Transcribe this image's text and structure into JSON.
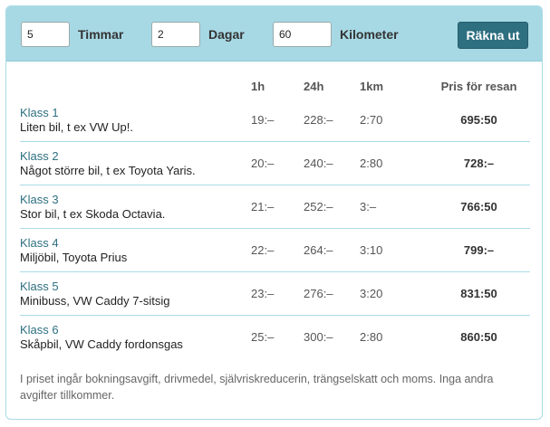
{
  "form": {
    "hours_value": "5",
    "hours_label": "Timmar",
    "days_value": "2",
    "days_label": "Dagar",
    "km_value": "60",
    "km_label": "Kilometer",
    "submit_label": "Räkna ut"
  },
  "table": {
    "headers": {
      "hour": "1h",
      "day": "24h",
      "km": "1km",
      "price": "Pris för resan"
    },
    "rows": [
      {
        "klass": "Klass 1",
        "desc": "Liten bil, t ex VW Up!.",
        "hour": "19:–",
        "day": "228:–",
        "km": "2:70",
        "price": "695:50"
      },
      {
        "klass": "Klass 2",
        "desc": "Något större bil, t ex Toyota Yaris.",
        "hour": "20:–",
        "day": "240:–",
        "km": "2:80",
        "price": "728:–"
      },
      {
        "klass": "Klass 3",
        "desc": "Stor bil, t ex Skoda Octavia.",
        "hour": "21:–",
        "day": "252:–",
        "km": "3:–",
        "price": "766:50"
      },
      {
        "klass": "Klass 4",
        "desc": "Miljöbil, Toyota Prius",
        "hour": "22:–",
        "day": "264:–",
        "km": "3:10",
        "price": "799:–"
      },
      {
        "klass": "Klass 5",
        "desc": "Minibuss, VW Caddy 7-sitsig",
        "hour": "23:–",
        "day": "276:–",
        "km": "3:20",
        "price": "831:50"
      },
      {
        "klass": "Klass 6",
        "desc": "Skåpbil, VW Caddy fordonsgas",
        "hour": "25:–",
        "day": "300:–",
        "km": "2:80",
        "price": "860:50"
      }
    ]
  },
  "footer_note": "I priset ingår bokningsavgift, drivmedel, självriskreducerin, trängselskatt och moms. Inga andra avgifter tillkommer."
}
